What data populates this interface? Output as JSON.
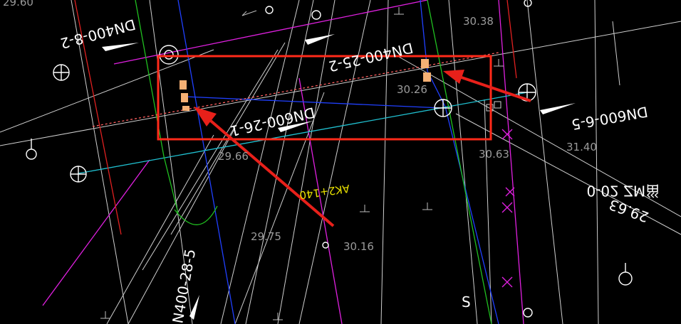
{
  "drawing": {
    "pipe_labels": {
      "dn400_8_2": "DN400-8-2",
      "dn400_25_2": "DN400-25-2",
      "dn600_26_1": "DN600-26-1",
      "dn600_6_5": "DN600-6-5",
      "dn400_28_5": "N400-28-5",
      "zm_0_02": "0-02 ZM甾"
    },
    "elevations": {
      "e3038": "30.38",
      "e3026": "30.26",
      "e3063": "30.63",
      "e2966": "29.66",
      "e2975": "29.75",
      "e3016": "30.16",
      "e2963": "29.63",
      "e3140": "31.40",
      "e2960": "29.60"
    },
    "annotation": "AK2+140",
    "side_text": "S"
  },
  "colors": {
    "background": "#000000",
    "highlight_box": "#ff2a1a",
    "arrow": "#e8201a",
    "pipe_magenta": "#e020e0",
    "pipe_blue": "#2040ff",
    "pipe_cyan": "#20c0d0",
    "pipe_green": "#20c020",
    "pipe_red": "#e02020",
    "line_white": "#d8d8d8",
    "valve_orange": "#f5b074"
  }
}
